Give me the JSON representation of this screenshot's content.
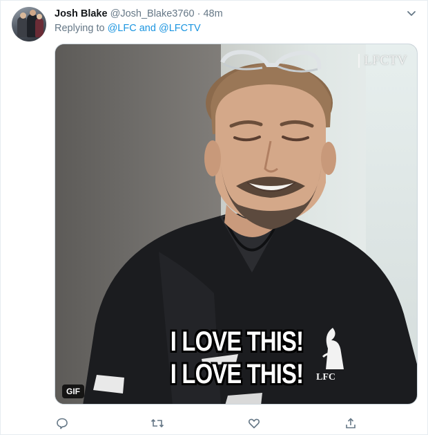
{
  "tweet": {
    "display_name": "Josh Blake",
    "handle": "@Josh_Blake3760",
    "separator": "·",
    "time": "48m",
    "replying_prefix": "Replying to",
    "mention_1": "@LFC",
    "and_word": "and",
    "mention_2": "@LFCTV"
  },
  "media": {
    "channel_logo": "LFCTV",
    "caption_line_1": "I LOVE THIS!",
    "caption_line_2": "I LOVE THIS!",
    "crest_text": "LFC",
    "badge": "GIF"
  },
  "icons": {
    "menu": "chevron-down-icon",
    "reply": "reply-icon",
    "retweet": "retweet-icon",
    "like": "heart-icon",
    "share": "share-icon"
  },
  "colors": {
    "link": "#1b95e0",
    "muted": "#657786",
    "text": "#14171a"
  }
}
